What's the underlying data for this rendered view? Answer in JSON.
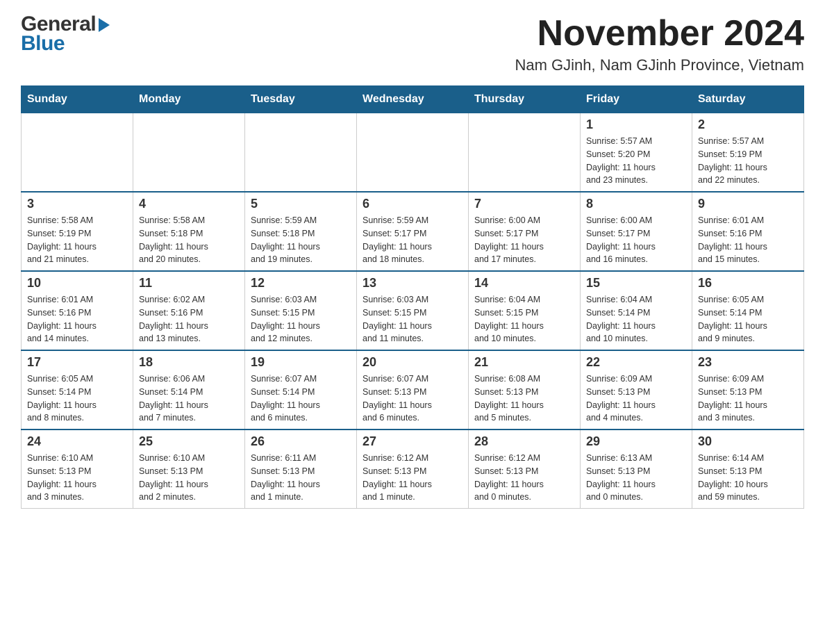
{
  "header": {
    "logo": {
      "general_text": "General",
      "blue_text": "Blue"
    },
    "month_title": "November 2024",
    "location": "Nam GJinh, Nam GJinh Province, Vietnam"
  },
  "weekdays": [
    "Sunday",
    "Monday",
    "Tuesday",
    "Wednesday",
    "Thursday",
    "Friday",
    "Saturday"
  ],
  "weeks": [
    {
      "days": [
        {
          "number": "",
          "info": ""
        },
        {
          "number": "",
          "info": ""
        },
        {
          "number": "",
          "info": ""
        },
        {
          "number": "",
          "info": ""
        },
        {
          "number": "",
          "info": ""
        },
        {
          "number": "1",
          "info": "Sunrise: 5:57 AM\nSunset: 5:20 PM\nDaylight: 11 hours\nand 23 minutes."
        },
        {
          "number": "2",
          "info": "Sunrise: 5:57 AM\nSunset: 5:19 PM\nDaylight: 11 hours\nand 22 minutes."
        }
      ]
    },
    {
      "days": [
        {
          "number": "3",
          "info": "Sunrise: 5:58 AM\nSunset: 5:19 PM\nDaylight: 11 hours\nand 21 minutes."
        },
        {
          "number": "4",
          "info": "Sunrise: 5:58 AM\nSunset: 5:18 PM\nDaylight: 11 hours\nand 20 minutes."
        },
        {
          "number": "5",
          "info": "Sunrise: 5:59 AM\nSunset: 5:18 PM\nDaylight: 11 hours\nand 19 minutes."
        },
        {
          "number": "6",
          "info": "Sunrise: 5:59 AM\nSunset: 5:17 PM\nDaylight: 11 hours\nand 18 minutes."
        },
        {
          "number": "7",
          "info": "Sunrise: 6:00 AM\nSunset: 5:17 PM\nDaylight: 11 hours\nand 17 minutes."
        },
        {
          "number": "8",
          "info": "Sunrise: 6:00 AM\nSunset: 5:17 PM\nDaylight: 11 hours\nand 16 minutes."
        },
        {
          "number": "9",
          "info": "Sunrise: 6:01 AM\nSunset: 5:16 PM\nDaylight: 11 hours\nand 15 minutes."
        }
      ]
    },
    {
      "days": [
        {
          "number": "10",
          "info": "Sunrise: 6:01 AM\nSunset: 5:16 PM\nDaylight: 11 hours\nand 14 minutes."
        },
        {
          "number": "11",
          "info": "Sunrise: 6:02 AM\nSunset: 5:16 PM\nDaylight: 11 hours\nand 13 minutes."
        },
        {
          "number": "12",
          "info": "Sunrise: 6:03 AM\nSunset: 5:15 PM\nDaylight: 11 hours\nand 12 minutes."
        },
        {
          "number": "13",
          "info": "Sunrise: 6:03 AM\nSunset: 5:15 PM\nDaylight: 11 hours\nand 11 minutes."
        },
        {
          "number": "14",
          "info": "Sunrise: 6:04 AM\nSunset: 5:15 PM\nDaylight: 11 hours\nand 10 minutes."
        },
        {
          "number": "15",
          "info": "Sunrise: 6:04 AM\nSunset: 5:14 PM\nDaylight: 11 hours\nand 10 minutes."
        },
        {
          "number": "16",
          "info": "Sunrise: 6:05 AM\nSunset: 5:14 PM\nDaylight: 11 hours\nand 9 minutes."
        }
      ]
    },
    {
      "days": [
        {
          "number": "17",
          "info": "Sunrise: 6:05 AM\nSunset: 5:14 PM\nDaylight: 11 hours\nand 8 minutes."
        },
        {
          "number": "18",
          "info": "Sunrise: 6:06 AM\nSunset: 5:14 PM\nDaylight: 11 hours\nand 7 minutes."
        },
        {
          "number": "19",
          "info": "Sunrise: 6:07 AM\nSunset: 5:14 PM\nDaylight: 11 hours\nand 6 minutes."
        },
        {
          "number": "20",
          "info": "Sunrise: 6:07 AM\nSunset: 5:13 PM\nDaylight: 11 hours\nand 6 minutes."
        },
        {
          "number": "21",
          "info": "Sunrise: 6:08 AM\nSunset: 5:13 PM\nDaylight: 11 hours\nand 5 minutes."
        },
        {
          "number": "22",
          "info": "Sunrise: 6:09 AM\nSunset: 5:13 PM\nDaylight: 11 hours\nand 4 minutes."
        },
        {
          "number": "23",
          "info": "Sunrise: 6:09 AM\nSunset: 5:13 PM\nDaylight: 11 hours\nand 3 minutes."
        }
      ]
    },
    {
      "days": [
        {
          "number": "24",
          "info": "Sunrise: 6:10 AM\nSunset: 5:13 PM\nDaylight: 11 hours\nand 3 minutes."
        },
        {
          "number": "25",
          "info": "Sunrise: 6:10 AM\nSunset: 5:13 PM\nDaylight: 11 hours\nand 2 minutes."
        },
        {
          "number": "26",
          "info": "Sunrise: 6:11 AM\nSunset: 5:13 PM\nDaylight: 11 hours\nand 1 minute."
        },
        {
          "number": "27",
          "info": "Sunrise: 6:12 AM\nSunset: 5:13 PM\nDaylight: 11 hours\nand 1 minute."
        },
        {
          "number": "28",
          "info": "Sunrise: 6:12 AM\nSunset: 5:13 PM\nDaylight: 11 hours\nand 0 minutes."
        },
        {
          "number": "29",
          "info": "Sunrise: 6:13 AM\nSunset: 5:13 PM\nDaylight: 11 hours\nand 0 minutes."
        },
        {
          "number": "30",
          "info": "Sunrise: 6:14 AM\nSunset: 5:13 PM\nDaylight: 10 hours\nand 59 minutes."
        }
      ]
    }
  ]
}
